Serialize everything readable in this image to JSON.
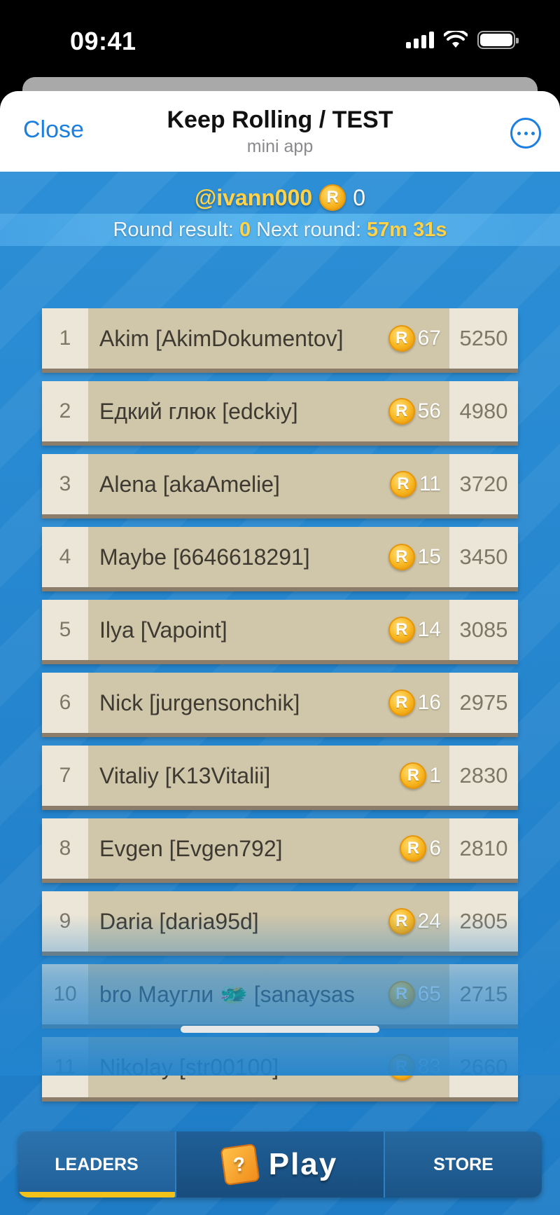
{
  "status": {
    "time": "09:41"
  },
  "header": {
    "close_label": "Close",
    "title": "Keep Rolling / TEST",
    "subtitle": "mini app",
    "more_icon": "ellipsis-circle-icon"
  },
  "user": {
    "handle": "@ivann000",
    "balance": "0",
    "coin_symbol": "R"
  },
  "round": {
    "result_label": "Round result:",
    "result_value": "0",
    "next_label": "Next round:",
    "next_value": "57m 31s"
  },
  "leaders": [
    {
      "rank": "1",
      "name": "Akim [AkimDokumentov]",
      "coins": "67",
      "score": "5250"
    },
    {
      "rank": "2",
      "name": "Едкий глюк [edckiy]",
      "coins": "56",
      "score": "4980"
    },
    {
      "rank": "3",
      "name": "Alena [akaAmelie]",
      "coins": "11",
      "score": "3720"
    },
    {
      "rank": "4",
      "name": "Maybe [6646618291]",
      "coins": "15",
      "score": "3450"
    },
    {
      "rank": "5",
      "name": "Ilya [Vapoint]",
      "coins": "14",
      "score": "3085"
    },
    {
      "rank": "6",
      "name": "Nick [jurgensonchik]",
      "coins": "16",
      "score": "2975"
    },
    {
      "rank": "7",
      "name": "Vitaliy [K13Vitalii]",
      "coins": "1",
      "score": "2830"
    },
    {
      "rank": "8",
      "name": "Evgen [Evgen792]",
      "coins": "6",
      "score": "2810"
    },
    {
      "rank": "9",
      "name": "Daria [daria95d]",
      "coins": "24",
      "score": "2805"
    },
    {
      "rank": "10",
      "name": "bro Маугли 🐲 [sanaysas",
      "coins": "65",
      "score": "2715"
    },
    {
      "rank": "11",
      "name": "Nikolay [str00100]",
      "coins": "83",
      "score": "2660"
    }
  ],
  "nav": {
    "leaders_label": "LEADERS",
    "play_label": "Play",
    "play_icon": "mystery-box-icon",
    "play_icon_glyph": "?",
    "store_label": "STORE"
  },
  "colors": {
    "accent": "#1a7fe0",
    "gold": "#ffd24a",
    "row_bg": "#d0c6a9",
    "background": "#2284ce"
  }
}
